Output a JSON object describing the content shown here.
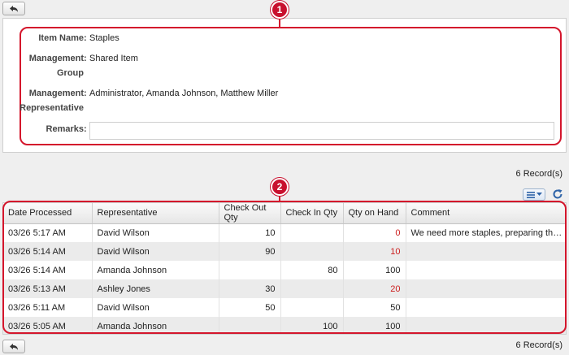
{
  "form": {
    "item_name_label": "Item Name",
    "item_name_value": "Staples",
    "mgmt_group_label_1": "Management",
    "mgmt_group_label_2": "Group",
    "mgmt_group_value": "Shared Item",
    "mgmt_rep_label_1": "Management",
    "mgmt_rep_label_2": "Representative",
    "mgmt_rep_value": "Administrator, Amanda Johnson, Matthew Miller",
    "remarks_label": "Remarks",
    "remarks_value": "",
    "colon": ":"
  },
  "markers": {
    "one": "1",
    "two": "2"
  },
  "records_text": "6 Record(s)",
  "table": {
    "headers": [
      "Date Processed",
      "Representative",
      "Check Out Qty",
      "Check In Qty",
      "Qty on Hand",
      "Comment"
    ],
    "rows": [
      [
        "03/26 5:17 AM",
        "David Wilson",
        "10",
        "",
        "0",
        "We need more staples, preparing the ne..."
      ],
      [
        "03/26 5:14 AM",
        "David Wilson",
        "90",
        "",
        "10",
        ""
      ],
      [
        "03/26 5:14 AM",
        "Amanda Johnson",
        "",
        "80",
        "100",
        ""
      ],
      [
        "03/26 5:13 AM",
        "Ashley Jones",
        "30",
        "",
        "20",
        ""
      ],
      [
        "03/26 5:11 AM",
        "David Wilson",
        "50",
        "",
        "50",
        ""
      ],
      [
        "03/26 5:05 AM",
        "Amanda Johnson",
        "",
        "100",
        "100",
        ""
      ]
    ],
    "low_stock_color": "#cc1f1f"
  },
  "icons": {
    "back": "back-arrow-icon",
    "view": "list-view-icon",
    "refresh": "refresh-icon"
  },
  "colors": {
    "highlight": "#d4162c",
    "marker": "#c8102e"
  }
}
